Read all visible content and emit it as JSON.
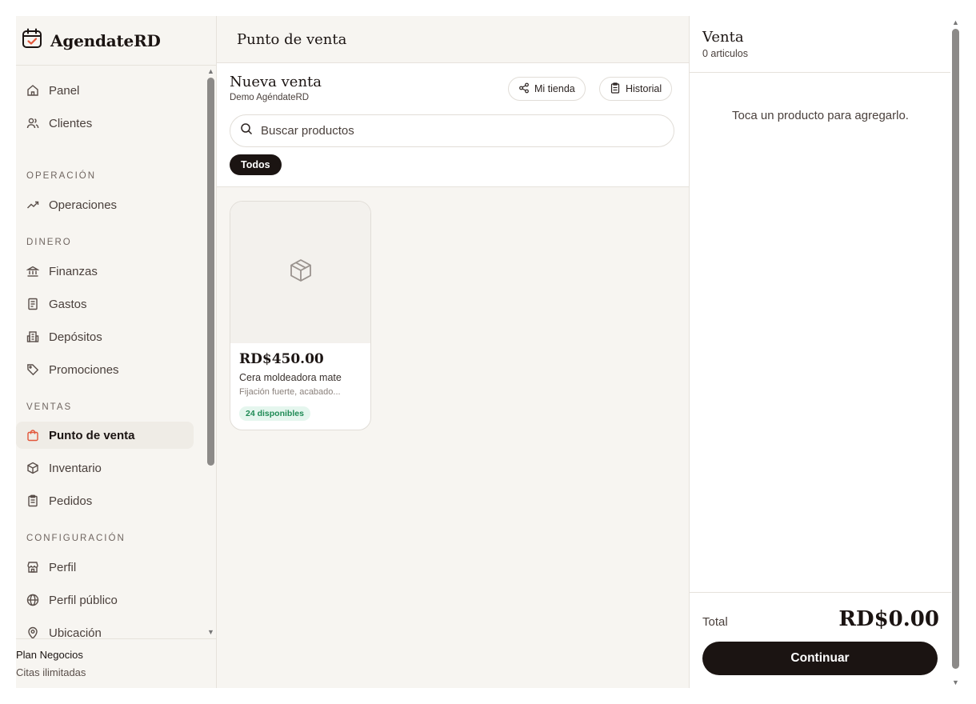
{
  "brand": {
    "name": "AgendateRD",
    "accent": "#e2563a"
  },
  "sidebar": {
    "items": [
      {
        "label": "Panel",
        "icon": "home-icon"
      },
      {
        "label": "Clientes",
        "icon": "users-icon"
      },
      {
        "label": "Operaciones",
        "icon": "trend-icon"
      },
      {
        "label": "Finanzas",
        "icon": "bank-icon"
      },
      {
        "label": "Gastos",
        "icon": "receipt-icon"
      },
      {
        "label": "Depósitos",
        "icon": "building-icon"
      },
      {
        "label": "Promociones",
        "icon": "tag-icon"
      },
      {
        "label": "Punto de venta",
        "icon": "bag-icon",
        "active": true
      },
      {
        "label": "Inventario",
        "icon": "box-icon"
      },
      {
        "label": "Pedidos",
        "icon": "clipboard-icon"
      },
      {
        "label": "Perfil",
        "icon": "store-icon"
      },
      {
        "label": "Perfil público",
        "icon": "globe-icon"
      },
      {
        "label": "Ubicación",
        "icon": "pin-icon"
      }
    ],
    "sections": [
      "OPERACIÓN",
      "DINERO",
      "VENTAS",
      "CONFIGURACIÓN"
    ],
    "plan": {
      "title": "Plan Negocios",
      "subtitle": "Citas ilimitadas"
    }
  },
  "main": {
    "page_title": "Punto de venta",
    "panel": {
      "title": "Nueva venta",
      "subtitle": "Demo AgéndateRD",
      "store_button": "Mi tienda",
      "history_button": "Historial",
      "search_placeholder": "Buscar productos",
      "filter_chip": "Todos"
    },
    "products": [
      {
        "price": "RD$450.00",
        "name": "Cera moldeadora mate",
        "description": "Fijación fuerte, acabado...",
        "stock": "24 disponibles"
      }
    ]
  },
  "cart": {
    "title": "Venta",
    "count": "0 articulos",
    "empty_message": "Toca un producto para agregarlo.",
    "total_label": "Total",
    "total_value": "RD$0.00",
    "continue_label": "Continuar"
  }
}
